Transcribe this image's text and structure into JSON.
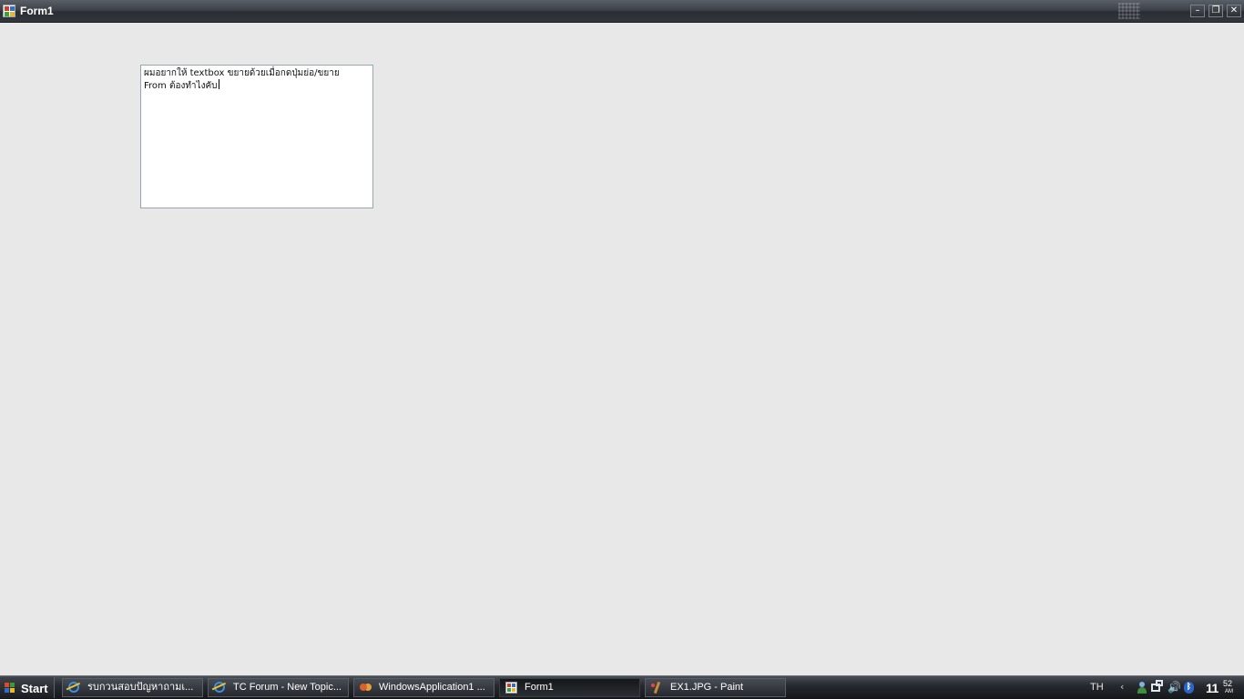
{
  "window": {
    "title": "Form1",
    "controls": {
      "minimize": "–",
      "maximize": "❐",
      "close": "✕"
    }
  },
  "textbox": {
    "lines": [
      "ผมอยากให้ textbox ขยายด้วยเมื่อกดปุ่มย่อ/ขยาย",
      "From ต้องทำไงคับ"
    ]
  },
  "taskbar": {
    "start_label": "Start",
    "tasks": [
      {
        "label": "รบกวนสอบปัญหาถามเ...",
        "icon": "internet-explorer-icon",
        "active": false
      },
      {
        "label": "TC Forum - New Topic...",
        "icon": "internet-explorer-icon",
        "active": false
      },
      {
        "label": "WindowsApplication1 ...",
        "icon": "visual-studio-icon",
        "active": false
      },
      {
        "label": "Form1",
        "icon": "form-icon",
        "active": true
      },
      {
        "label": "EX1.JPG - Paint",
        "icon": "paint-icon",
        "active": false
      }
    ],
    "language": "TH",
    "tray": {
      "chevron": "‹",
      "volume_glyph": "🔊",
      "bluetooth_glyph": "ᛒ"
    },
    "clock": {
      "hour": "11",
      "minute": "52",
      "ampm": "AM"
    }
  }
}
